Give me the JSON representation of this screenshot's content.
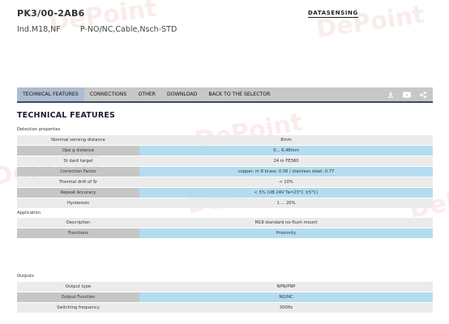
{
  "product": {
    "code": "PK3/00-2AB6",
    "description": "Ind.M18,NF        P-NO/NC,Cable,Nsch-STD",
    "brand_logo": "DATASENSING"
  },
  "watermark": "DePoint",
  "nav": {
    "tabs": [
      {
        "label": "TECHNICAL FEATURES",
        "active": true
      },
      {
        "label": "CONNECTIONS",
        "active": false
      },
      {
        "label": "OTHER",
        "active": false
      },
      {
        "label": "DOWNLOAD",
        "active": false
      },
      {
        "label": "BACK TO THE SELECTOR",
        "active": false
      }
    ],
    "icons": [
      "download-icon",
      "video-icon",
      "share-icon"
    ]
  },
  "section_title": "TECHNICAL FEATURES",
  "groups": [
    {
      "label": "Detection properties",
      "rows": [
        {
          "key": "Nominal sensing distance",
          "value": "8mm"
        },
        {
          "key": "Ope      g distance",
          "value": "0... 6,48mm"
        },
        {
          "key": "St      dard target",
          "value": "24      m   FE360"
        },
        {
          "key": "Correction Factor",
          "value": "copper:      m                 8   brass: 0.56 / stainless steel: 0.77"
        },
        {
          "key": "Thermal drift of Sr",
          "value": "< 10%"
        },
        {
          "key": "Repeat Accuracy",
          "value": "< 5% (UB 24V Ta=23°C ±5°C)"
        },
        {
          "key": "Hysteresis",
          "value": "1 ... 20%"
        }
      ]
    },
    {
      "label": "Application",
      "rows": [
        {
          "key": "Description",
          "value": "M18 standard no-flush mount"
        },
        {
          "key": "Functions",
          "value": "Proximity"
        }
      ]
    },
    {
      "label": "Outputs",
      "rows": [
        {
          "key": "Output type",
          "value": "NPN/PNP"
        },
        {
          "key": "Output Function",
          "value": "NO/NC"
        },
        {
          "key": "Switching frequency",
          "value": "300Hz"
        }
      ]
    }
  ],
  "colors": {
    "nav_bg": "#c8c8c8",
    "nav_active": "#aebcd0",
    "nav_underline": "#3a4a66",
    "row_light": "#ebebeb",
    "row_dark_key": "#c6c6c6",
    "row_dark_value": "#b4dcf0"
  }
}
